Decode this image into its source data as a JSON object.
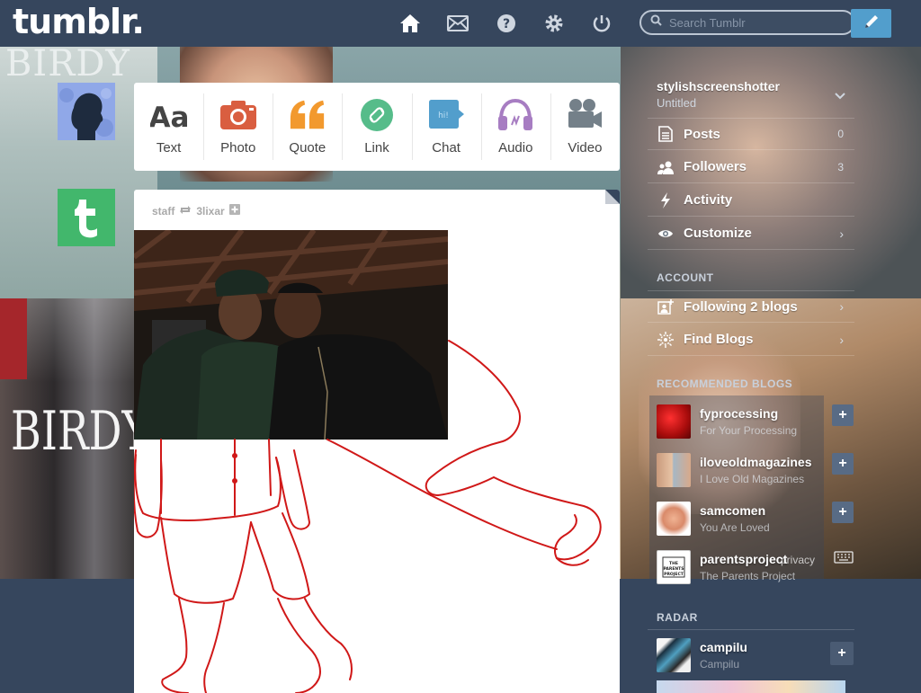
{
  "app": {
    "logo": "tumblr."
  },
  "nav": {
    "items": [
      {
        "name": "dashboard",
        "icon": "home-icon"
      },
      {
        "name": "inbox",
        "icon": "mail-icon"
      },
      {
        "name": "help",
        "icon": "help-icon"
      },
      {
        "name": "settings",
        "icon": "gear-icon"
      },
      {
        "name": "logout",
        "icon": "power-icon"
      }
    ],
    "search_placeholder": "Search Tumblr",
    "compose_icon": "pencil-icon"
  },
  "background": {
    "birdy_top": "BIRDY",
    "birdy_bottom": "BIRDY"
  },
  "post_types": [
    {
      "label": "Text",
      "icon": "text-icon",
      "color": "#444444"
    },
    {
      "label": "Photo",
      "icon": "camera-icon",
      "color": "#d95e40"
    },
    {
      "label": "Quote",
      "icon": "quote-icon",
      "color": "#f2992e"
    },
    {
      "label": "Link",
      "icon": "link-icon",
      "color": "#56bc8a"
    },
    {
      "label": "Chat",
      "icon": "chat-icon",
      "color": "#529ecc"
    },
    {
      "label": "Audio",
      "icon": "headphones-icon",
      "color": "#a77dc2"
    },
    {
      "label": "Video",
      "icon": "video-camera-icon",
      "color": "#748089"
    }
  ],
  "post": {
    "author": "staff",
    "reblogged_from": "3lixar",
    "reblog_icon": "reblog-icon",
    "follow_icon": "plus-icon"
  },
  "sidebar": {
    "blog_name": "stylishscreenshotter",
    "blog_title": "Untitled",
    "rows": [
      {
        "label": "Posts",
        "count": "0",
        "icon": "posts-icon"
      },
      {
        "label": "Followers",
        "count": "3",
        "icon": "followers-icon"
      },
      {
        "label": "Activity",
        "count": "",
        "icon": "lightning-icon"
      },
      {
        "label": "Customize",
        "count": "",
        "icon": "eye-icon",
        "arrow": "›"
      }
    ],
    "account_heading": "ACCOUNT",
    "account_rows": [
      {
        "label": "Following 2 blogs",
        "icon": "following-icon",
        "arrow": "›"
      },
      {
        "label": "Find Blogs",
        "icon": "compass-icon",
        "arrow": "›"
      }
    ],
    "recommended_heading": "RECOMMENDED BLOGS",
    "recommended": [
      {
        "name": "fyprocessing",
        "title": "For Your Processing",
        "avatar_color": "#c21818"
      },
      {
        "name": "iloveoldmagazines",
        "title": "I Love Old Magazines",
        "avatar_color": "#8fa6b5"
      },
      {
        "name": "samcomen",
        "title": "You Are Loved",
        "avatar_color": "#e9a78d"
      },
      {
        "name": "parentsproject",
        "title": "The Parents Project",
        "avatar_color": "#ffffff",
        "overlay": "privacy"
      }
    ],
    "radar_heading": "RADAR",
    "radar": {
      "name": "campilu",
      "title": "Campilu",
      "avatar_color": "#5a8fb0"
    }
  }
}
